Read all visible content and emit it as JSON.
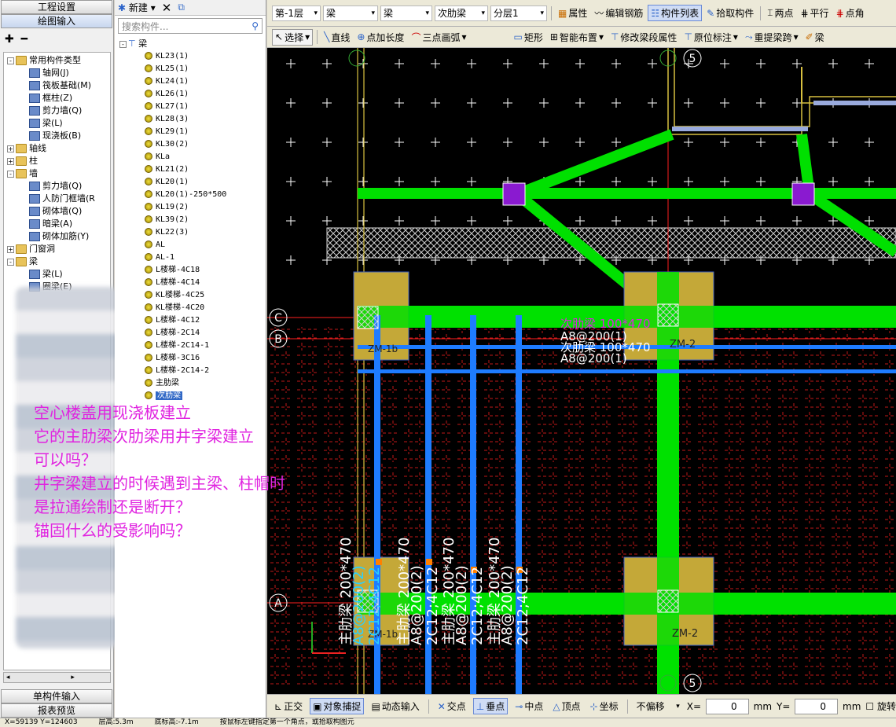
{
  "nav": {
    "top_buttons": [
      "工程设置",
      "绘图输入"
    ],
    "bottom_buttons": [
      "单构件输入",
      "报表预览"
    ],
    "tools": "✚ ━",
    "tree": [
      {
        "label": "常用构件类型",
        "pm": "-",
        "folder": true,
        "indent": 0
      },
      {
        "label": "轴网(J)",
        "indent": 2
      },
      {
        "label": "筏板基础(M)",
        "indent": 2
      },
      {
        "label": "框柱(Z)",
        "indent": 2
      },
      {
        "label": "剪力墙(Q)",
        "indent": 2
      },
      {
        "label": "梁(L)",
        "indent": 2
      },
      {
        "label": "现浇板(B)",
        "indent": 2
      },
      {
        "label": "轴线",
        "pm": "+",
        "folder": true,
        "indent": 0
      },
      {
        "label": "柱",
        "pm": "+",
        "folder": true,
        "indent": 0
      },
      {
        "label": "墙",
        "pm": "-",
        "folder": true,
        "indent": 0
      },
      {
        "label": "剪力墙(Q)",
        "indent": 2
      },
      {
        "label": "人防门框墙(R",
        "indent": 2
      },
      {
        "label": "砌体墙(Q)",
        "indent": 2
      },
      {
        "label": "暗梁(A)",
        "indent": 2
      },
      {
        "label": "砌体加筋(Y)",
        "indent": 2
      },
      {
        "label": "门窗洞",
        "pm": "+",
        "folder": true,
        "indent": 0
      },
      {
        "label": "梁",
        "pm": "-",
        "folder": true,
        "indent": 0
      },
      {
        "label": "梁(L)",
        "indent": 2
      },
      {
        "label": "圈梁(E)",
        "indent": 2
      }
    ]
  },
  "list": {
    "new_label": "新建",
    "search_placeholder": "搜索构件...",
    "root": "梁",
    "items": [
      "KL23(1)",
      "KL25(1)",
      "KL24(1)",
      "KL26(1)",
      "KL27(1)",
      "KL28(3)",
      "KL29(1)",
      "KL30(2)",
      "KLa",
      "KL21(2)",
      "KL20(1)",
      "KL20(1)-250*500",
      "KL19(2)",
      "KL39(2)",
      "KL22(3)",
      "AL",
      "AL-1",
      "L楼梯-4C18",
      "L楼梯-4C14",
      "KL楼梯-4C25",
      "KL楼梯-4C20",
      "L楼梯-4C12",
      "L楼梯-2C14",
      "L楼梯-2C14-1",
      "L楼梯-3C16",
      "L楼梯-2C14-2",
      "主肋梁",
      "次肋梁"
    ],
    "selected": "次肋梁"
  },
  "toolbar1": {
    "floor": "第-1层",
    "type1": "梁",
    "type2": "梁",
    "member": "次肋梁",
    "layer": "分层1",
    "buttons": [
      "属性",
      "编辑钢筋",
      "构件列表",
      "拾取构件",
      "两点",
      "平行",
      "点角"
    ],
    "active": "构件列表"
  },
  "toolbar2": {
    "select": "选择",
    "buttons": [
      "直线",
      "点加长度",
      "三点画弧",
      "矩形",
      "智能布置",
      "修改梁段属性",
      "原位标注",
      "重提梁跨",
      "梁"
    ]
  },
  "canvas": {
    "axis_labels": {
      "c": "C",
      "b": "B",
      "a": "A",
      "n5": "5"
    },
    "texts": [
      {
        "k": "t1",
        "v": "次肋梁 100*470"
      },
      {
        "k": "t2",
        "v": "A8@200(1)"
      },
      {
        "k": "t3",
        "v": "次肋梁 100*470"
      },
      {
        "k": "t4",
        "v": "A8@200(1)"
      },
      {
        "k": "t5",
        "v": "ZM-2"
      },
      {
        "k": "t6",
        "v": "ZM-1b"
      },
      {
        "k": "t7",
        "v": "ZM-1b"
      },
      {
        "k": "t8",
        "v": "ZM-2"
      }
    ],
    "vlabels": [
      {
        "a": "主肋梁 200*470",
        "b": "A8@200(2)",
        "c": "2C12;4C12"
      },
      {
        "a": "主肋梁 200*470",
        "b": "A8@200(2)",
        "c": "2C12;4C12"
      },
      {
        "a": "主肋梁 200*470",
        "b": "A8@200(2)",
        "c": "2C12;4C12"
      },
      {
        "a": "主肋梁 200*470",
        "b": "A8@200(2)",
        "c": "2C12;4C12"
      }
    ],
    "colors": {
      "beam": "#00e000",
      "rib": "#1e7cff",
      "column": "#c4a838",
      "grid": "#ff2020"
    }
  },
  "overlay": [
    "空心楼盖用现浇板建立",
    "它的主肋梁次肋梁用井字梁建立",
    "可以吗？",
    "井字梁建立的时候遇到主梁、柱帽时",
    "是拉通绘制还是断开？",
    "锚固什么的受影响吗？"
  ],
  "status": {
    "buttons": [
      "正交",
      "对象捕捉",
      "动态输入",
      "交点",
      "垂点",
      "中点",
      "顶点",
      "坐标"
    ],
    "offset": "不偏移",
    "x_label": "X=",
    "x_val": "0",
    "x_unit": "mm",
    "y_label": "Y=",
    "y_val": "0",
    "y_unit": "mm",
    "rotate": "旋转"
  },
  "bottom": {
    "coords": "X=59139 Y=124603",
    "floor_h": "层高:5.3m",
    "base_h": "底标高:-7.1m",
    "hint": "按鼠标左键指定第一个角点，或拾取构图元"
  }
}
